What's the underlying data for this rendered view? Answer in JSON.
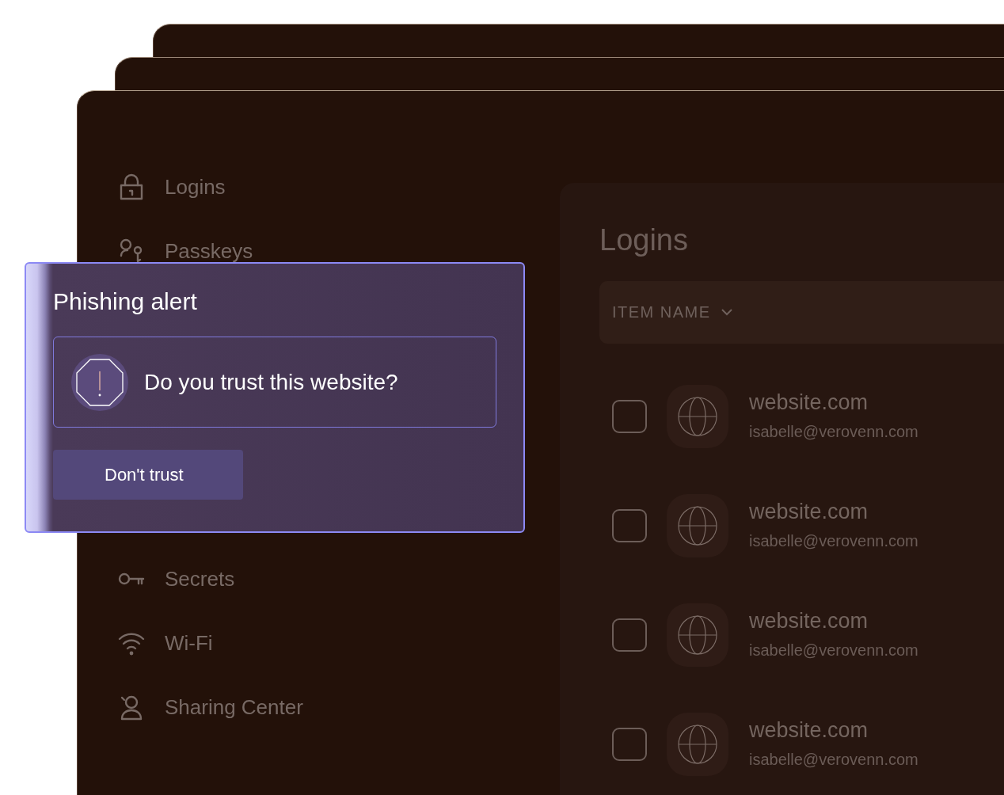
{
  "sidebar": {
    "items": [
      {
        "label": "Logins"
      },
      {
        "label": "Passkeys"
      },
      {
        "label": "Secrets"
      },
      {
        "label": "Wi-Fi"
      },
      {
        "label": "Sharing Center"
      }
    ]
  },
  "logins_panel": {
    "title": "Logins",
    "columns": [
      {
        "label": "ITEM NAME"
      }
    ],
    "rows": [
      {
        "site": "website.com",
        "email": "isabelle@verovenn.com",
        "checked": false
      },
      {
        "site": "website.com",
        "email": "isabelle@verovenn.com",
        "checked": false
      },
      {
        "site": "website.com",
        "email": "isabelle@verovenn.com",
        "checked": false
      },
      {
        "site": "website.com",
        "email": "isabelle@verovenn.com",
        "checked": false
      }
    ]
  },
  "phishing_alert": {
    "title": "Phishing alert",
    "message": "Do you trust this website?",
    "buttons": [
      "Don't trust"
    ]
  }
}
